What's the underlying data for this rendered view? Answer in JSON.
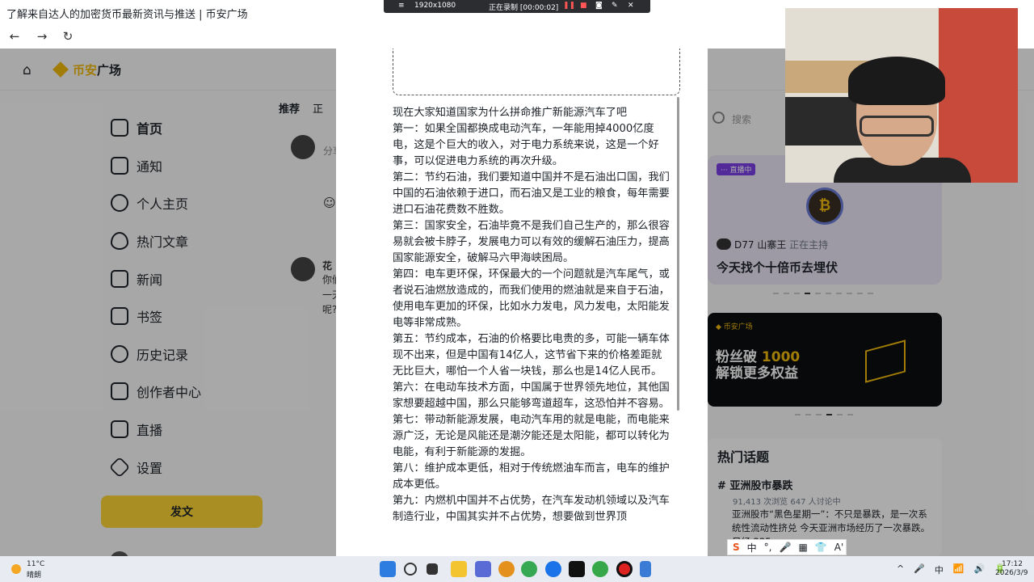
{
  "browser": {
    "tab_title": "了解来自达人的加密货币最新资讯与推送 | 币安广场",
    "back": "←",
    "forward": "→",
    "reload": "↻"
  },
  "recorder": {
    "resolution": "1920x1080",
    "status": "正在录制 [00:00:02]"
  },
  "app": {
    "brand": "币安广场",
    "brand_part1": "币安",
    "brand_part2": "广场"
  },
  "sidebar": {
    "items": [
      {
        "label": "首页",
        "icon": "home-feed-icon"
      },
      {
        "label": "通知",
        "icon": "bell-icon"
      },
      {
        "label": "个人主页",
        "icon": "profile-icon"
      },
      {
        "label": "热门文章",
        "icon": "flame-icon"
      },
      {
        "label": "新闻",
        "icon": "news-icon"
      },
      {
        "label": "书签",
        "icon": "bookmark-icon"
      },
      {
        "label": "历史记录",
        "icon": "history-icon"
      },
      {
        "label": "创作者中心",
        "icon": "creator-icon"
      },
      {
        "label": "直播",
        "icon": "video-icon"
      },
      {
        "label": "设置",
        "icon": "settings-icon"
      }
    ],
    "post_button": "发文"
  },
  "feed": {
    "tabs": [
      "推荐",
      "正"
    ],
    "compose_placeholder": "分享",
    "author_fragment": "花",
    "text_fragments": [
      "你们",
      "一天",
      "呢?"
    ]
  },
  "modal": {
    "article": [
      "现在大家知道国家为什么拼命推广新能源汽车了吧",
      "第一：如果全国都换成电动汽车，一年能用掉4000亿度电，这是个巨大的收入，对于电力系统来说，这是一个好事，可以促进电力系统的再次升级。",
      "第二：节约石油，我们要知道中国并不是石油出口国，我们中国的石油依赖于进口，而石油又是工业的粮食，每年需要进口石油花费数不胜数。",
      "第三：国家安全，石油毕竟不是我们自己生产的，那么很容易就会被卡脖子，发展电力可以有效的缓解石油压力，提高国家能源安全，破解马六甲海峡困局。",
      "第四：电车更环保，环保最大的一个问题就是汽车尾气，或者说石油燃放造成的，而我们使用的燃油就是来自于石油，使用电车更加的环保，比如水力发电，风力发电，太阳能发电等非常成熟。",
      "第五：节约成本，石油的价格要比电贵的多，可能一辆车体现不出来，但是中国有14亿人，这节省下来的价格差距就无比巨大，哪怕一个人省一块钱，那么也是14亿人民币。",
      "第六：在电动车技术方面，中国属于世界领先地位，其他国家想要超越中国，那么只能够弯道超车，这恐怕并不容易。",
      "第七：带动新能源发展，电动汽车用的就是电能，而电能来源广泛，无论是风能还是潮汐能还是太阳能，都可以转化为电能，有利于新能源的发掘。",
      "第八：维护成本更低，相对于传统燃油车而言，电车的维护成本更低。",
      "第九：内燃机中国并不占优势，在汽车发动机领域以及汽车制造行业，中国其实并不占优势，想要做到世界顶"
    ]
  },
  "right": {
    "search_placeholder": "搜索",
    "live": {
      "badge": "··· 直播中",
      "host": "D77 山寨王",
      "host_status": "正在主持",
      "title": "今天找个十倍币去埋伏",
      "coin_glyph": "₿",
      "dots_total": 10,
      "dots_active_index": 3
    },
    "promo": {
      "brand": "◆ 币安广场",
      "line1_a": "粉丝破 ",
      "line1_b": "1000",
      "line2": "解锁更多权益",
      "dots_total": 6,
      "dots_active_index": 3
    },
    "topics": {
      "title": "热门话题",
      "name": "# 亚洲股市暴跌",
      "stats": "91,413 次浏览  647 人讨论中",
      "news": "亚洲股市“黑色星期一”：不只是暴跌，是一次系统性流动性挤兑 今天亚洲市场经历了一次暴跌。日经 225 ..."
    }
  },
  "ime": {
    "items": [
      "S",
      "中",
      "°,",
      "🎤",
      "▦",
      "👕",
      "Aꞌ"
    ]
  },
  "taskbar": {
    "weather_temp": "11°C",
    "weather_desc": "晴朗",
    "time": "17:12",
    "date": "2026/3/9",
    "tray": [
      "^",
      "🎤",
      "中",
      "📶",
      "🔊",
      "🔋"
    ]
  },
  "colors": {
    "accent": "#f0b90b",
    "button": "#fcd535",
    "live": "#7b3fe4"
  }
}
